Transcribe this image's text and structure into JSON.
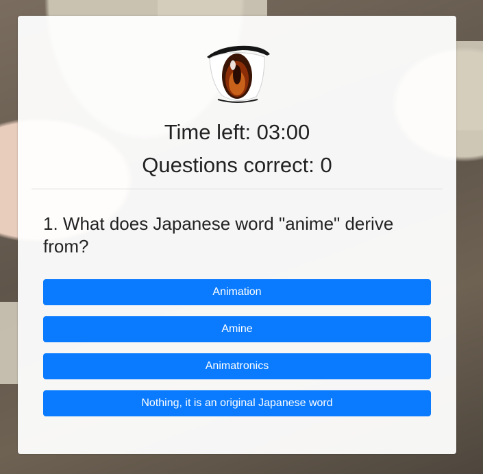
{
  "quiz": {
    "time_left": "Time left: 03:00",
    "questions_correct": "Questions correct: 0",
    "question": "1. What does Japanese word \"anime\" derive from?",
    "answers": [
      "Animation",
      "Amine",
      "Animatronics",
      "Nothing, it is an original Japanese word"
    ]
  },
  "logo": {
    "icon": "anime-eye-icon"
  },
  "colors": {
    "button": "#0a7bff",
    "card": "#ffffff",
    "text": "#222222"
  }
}
